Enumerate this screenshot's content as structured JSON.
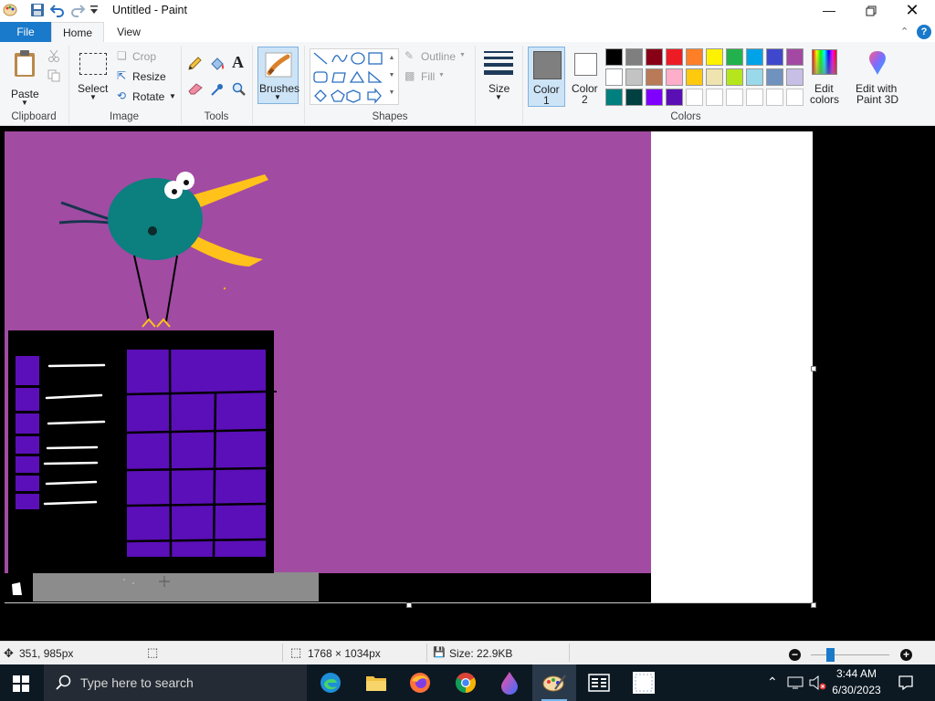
{
  "window": {
    "title": "Untitled - Paint",
    "qat_icons": [
      "paint-app-icon",
      "save-icon",
      "undo-icon",
      "redo-icon",
      "customize-qat-icon"
    ]
  },
  "tabs": {
    "file": "File",
    "home": "Home",
    "view": "View"
  },
  "clipboard": {
    "paste": "Paste",
    "group": "Clipboard"
  },
  "image": {
    "select": "Select",
    "crop": "Crop",
    "resize": "Resize",
    "rotate": "Rotate",
    "group": "Image"
  },
  "tools": {
    "group": "Tools"
  },
  "brushes": {
    "label": "Brushes"
  },
  "shapes": {
    "outline": "Outline",
    "fill": "Fill",
    "group": "Shapes"
  },
  "size": {
    "label": "Size"
  },
  "colors": {
    "color1_label": "Color 1",
    "color1_line1": "Color",
    "color1_line2": "1",
    "color2_line1": "Color",
    "color2_line2": "2",
    "color1_value": "#7f7f7f",
    "color2_value": "#ffffff",
    "palette_row1": [
      "#000000",
      "#7f7f7f",
      "#880015",
      "#ed1c24",
      "#ff7f27",
      "#fff200",
      "#22b14c",
      "#00a2e8",
      "#3f48cc",
      "#a349a4"
    ],
    "palette_row2": [
      "#ffffff",
      "#c3c3c3",
      "#b97a57",
      "#ffaec9",
      "#ffc90e",
      "#efe4b0",
      "#b5e61d",
      "#99d9ea",
      "#7092be",
      "#c8bfe7"
    ],
    "palette_row3": [
      "#007f7f",
      "#004040",
      "#7f00ff",
      "#5a0fb4"
    ],
    "edit_line1": "Edit",
    "edit_line2": "colors",
    "paint3d_line1": "Edit with",
    "paint3d_line2": "Paint 3D",
    "group": "Colors"
  },
  "status": {
    "cursor": "351, 985px",
    "dimensions": "1768 × 1034px",
    "size": "Size: 22.9KB",
    "zoom": "100%"
  },
  "taskbar": {
    "search_placeholder": "Type here to search",
    "apps": [
      "edge-icon",
      "file-explorer-icon",
      "firefox-icon",
      "chrome-icon",
      "color-picker-app-icon",
      "paint-app-icon",
      "task-manager-icon",
      "snip-app-icon"
    ],
    "time": "3:44 AM",
    "date": "6/30/2023"
  }
}
